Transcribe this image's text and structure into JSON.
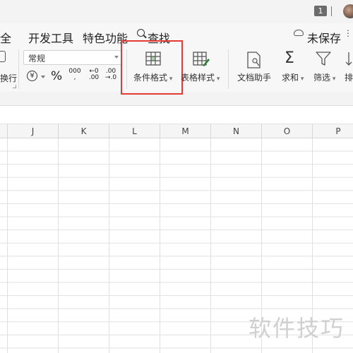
{
  "titlebar": {
    "badge": "1"
  },
  "menu": {
    "items": [
      "全",
      "开发工具",
      "特色功能",
      "查找"
    ],
    "save_status": "未保存",
    "share": "⋮"
  },
  "ribbon": {
    "clipboard_label": "换行",
    "number_format": {
      "selected": "常规"
    },
    "number_buttons": {
      "currency": "¥",
      "percent": "%",
      "thousands_top": "000",
      "thousands_bottom": ",",
      "inc_top": "←0",
      "inc_bottom": ".00",
      "dec_top": ".00",
      "dec_bottom": "→.0"
    },
    "conditional_format": "条件格式",
    "table_style": "表格样式",
    "doc_assistant": "文档助手",
    "sum": "求和",
    "sum_symbol": "Σ",
    "filter": "筛选",
    "sort": "排"
  },
  "sheet": {
    "columns": [
      "J",
      "K",
      "L",
      "M",
      "N",
      "O",
      "P"
    ]
  },
  "watermark": "软件技巧",
  "colors": {
    "highlight": "#e53935",
    "accent_green": "#2e7d32"
  }
}
